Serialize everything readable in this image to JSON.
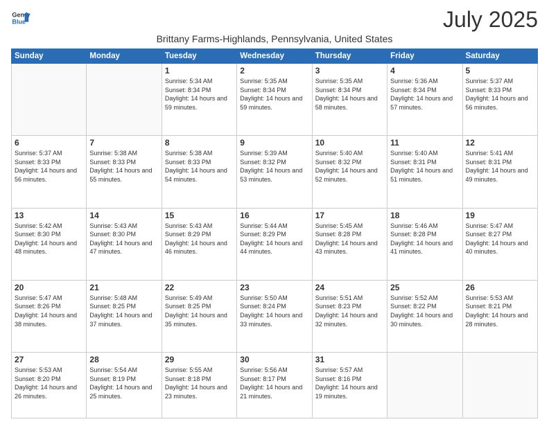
{
  "header": {
    "logo_line1": "General",
    "logo_line2": "Blue",
    "main_title": "July 2025",
    "location": "Brittany Farms-Highlands, Pennsylvania, United States"
  },
  "days_of_week": [
    "Sunday",
    "Monday",
    "Tuesday",
    "Wednesday",
    "Thursday",
    "Friday",
    "Saturday"
  ],
  "weeks": [
    [
      {
        "day": "",
        "info": ""
      },
      {
        "day": "",
        "info": ""
      },
      {
        "day": "1",
        "info": "Sunrise: 5:34 AM\nSunset: 8:34 PM\nDaylight: 14 hours and 59 minutes."
      },
      {
        "day": "2",
        "info": "Sunrise: 5:35 AM\nSunset: 8:34 PM\nDaylight: 14 hours and 59 minutes."
      },
      {
        "day": "3",
        "info": "Sunrise: 5:35 AM\nSunset: 8:34 PM\nDaylight: 14 hours and 58 minutes."
      },
      {
        "day": "4",
        "info": "Sunrise: 5:36 AM\nSunset: 8:34 PM\nDaylight: 14 hours and 57 minutes."
      },
      {
        "day": "5",
        "info": "Sunrise: 5:37 AM\nSunset: 8:33 PM\nDaylight: 14 hours and 56 minutes."
      }
    ],
    [
      {
        "day": "6",
        "info": "Sunrise: 5:37 AM\nSunset: 8:33 PM\nDaylight: 14 hours and 56 minutes."
      },
      {
        "day": "7",
        "info": "Sunrise: 5:38 AM\nSunset: 8:33 PM\nDaylight: 14 hours and 55 minutes."
      },
      {
        "day": "8",
        "info": "Sunrise: 5:38 AM\nSunset: 8:33 PM\nDaylight: 14 hours and 54 minutes."
      },
      {
        "day": "9",
        "info": "Sunrise: 5:39 AM\nSunset: 8:32 PM\nDaylight: 14 hours and 53 minutes."
      },
      {
        "day": "10",
        "info": "Sunrise: 5:40 AM\nSunset: 8:32 PM\nDaylight: 14 hours and 52 minutes."
      },
      {
        "day": "11",
        "info": "Sunrise: 5:40 AM\nSunset: 8:31 PM\nDaylight: 14 hours and 51 minutes."
      },
      {
        "day": "12",
        "info": "Sunrise: 5:41 AM\nSunset: 8:31 PM\nDaylight: 14 hours and 49 minutes."
      }
    ],
    [
      {
        "day": "13",
        "info": "Sunrise: 5:42 AM\nSunset: 8:30 PM\nDaylight: 14 hours and 48 minutes."
      },
      {
        "day": "14",
        "info": "Sunrise: 5:43 AM\nSunset: 8:30 PM\nDaylight: 14 hours and 47 minutes."
      },
      {
        "day": "15",
        "info": "Sunrise: 5:43 AM\nSunset: 8:29 PM\nDaylight: 14 hours and 46 minutes."
      },
      {
        "day": "16",
        "info": "Sunrise: 5:44 AM\nSunset: 8:29 PM\nDaylight: 14 hours and 44 minutes."
      },
      {
        "day": "17",
        "info": "Sunrise: 5:45 AM\nSunset: 8:28 PM\nDaylight: 14 hours and 43 minutes."
      },
      {
        "day": "18",
        "info": "Sunrise: 5:46 AM\nSunset: 8:28 PM\nDaylight: 14 hours and 41 minutes."
      },
      {
        "day": "19",
        "info": "Sunrise: 5:47 AM\nSunset: 8:27 PM\nDaylight: 14 hours and 40 minutes."
      }
    ],
    [
      {
        "day": "20",
        "info": "Sunrise: 5:47 AM\nSunset: 8:26 PM\nDaylight: 14 hours and 38 minutes."
      },
      {
        "day": "21",
        "info": "Sunrise: 5:48 AM\nSunset: 8:25 PM\nDaylight: 14 hours and 37 minutes."
      },
      {
        "day": "22",
        "info": "Sunrise: 5:49 AM\nSunset: 8:25 PM\nDaylight: 14 hours and 35 minutes."
      },
      {
        "day": "23",
        "info": "Sunrise: 5:50 AM\nSunset: 8:24 PM\nDaylight: 14 hours and 33 minutes."
      },
      {
        "day": "24",
        "info": "Sunrise: 5:51 AM\nSunset: 8:23 PM\nDaylight: 14 hours and 32 minutes."
      },
      {
        "day": "25",
        "info": "Sunrise: 5:52 AM\nSunset: 8:22 PM\nDaylight: 14 hours and 30 minutes."
      },
      {
        "day": "26",
        "info": "Sunrise: 5:53 AM\nSunset: 8:21 PM\nDaylight: 14 hours and 28 minutes."
      }
    ],
    [
      {
        "day": "27",
        "info": "Sunrise: 5:53 AM\nSunset: 8:20 PM\nDaylight: 14 hours and 26 minutes."
      },
      {
        "day": "28",
        "info": "Sunrise: 5:54 AM\nSunset: 8:19 PM\nDaylight: 14 hours and 25 minutes."
      },
      {
        "day": "29",
        "info": "Sunrise: 5:55 AM\nSunset: 8:18 PM\nDaylight: 14 hours and 23 minutes."
      },
      {
        "day": "30",
        "info": "Sunrise: 5:56 AM\nSunset: 8:17 PM\nDaylight: 14 hours and 21 minutes."
      },
      {
        "day": "31",
        "info": "Sunrise: 5:57 AM\nSunset: 8:16 PM\nDaylight: 14 hours and 19 minutes."
      },
      {
        "day": "",
        "info": ""
      },
      {
        "day": "",
        "info": ""
      }
    ]
  ]
}
